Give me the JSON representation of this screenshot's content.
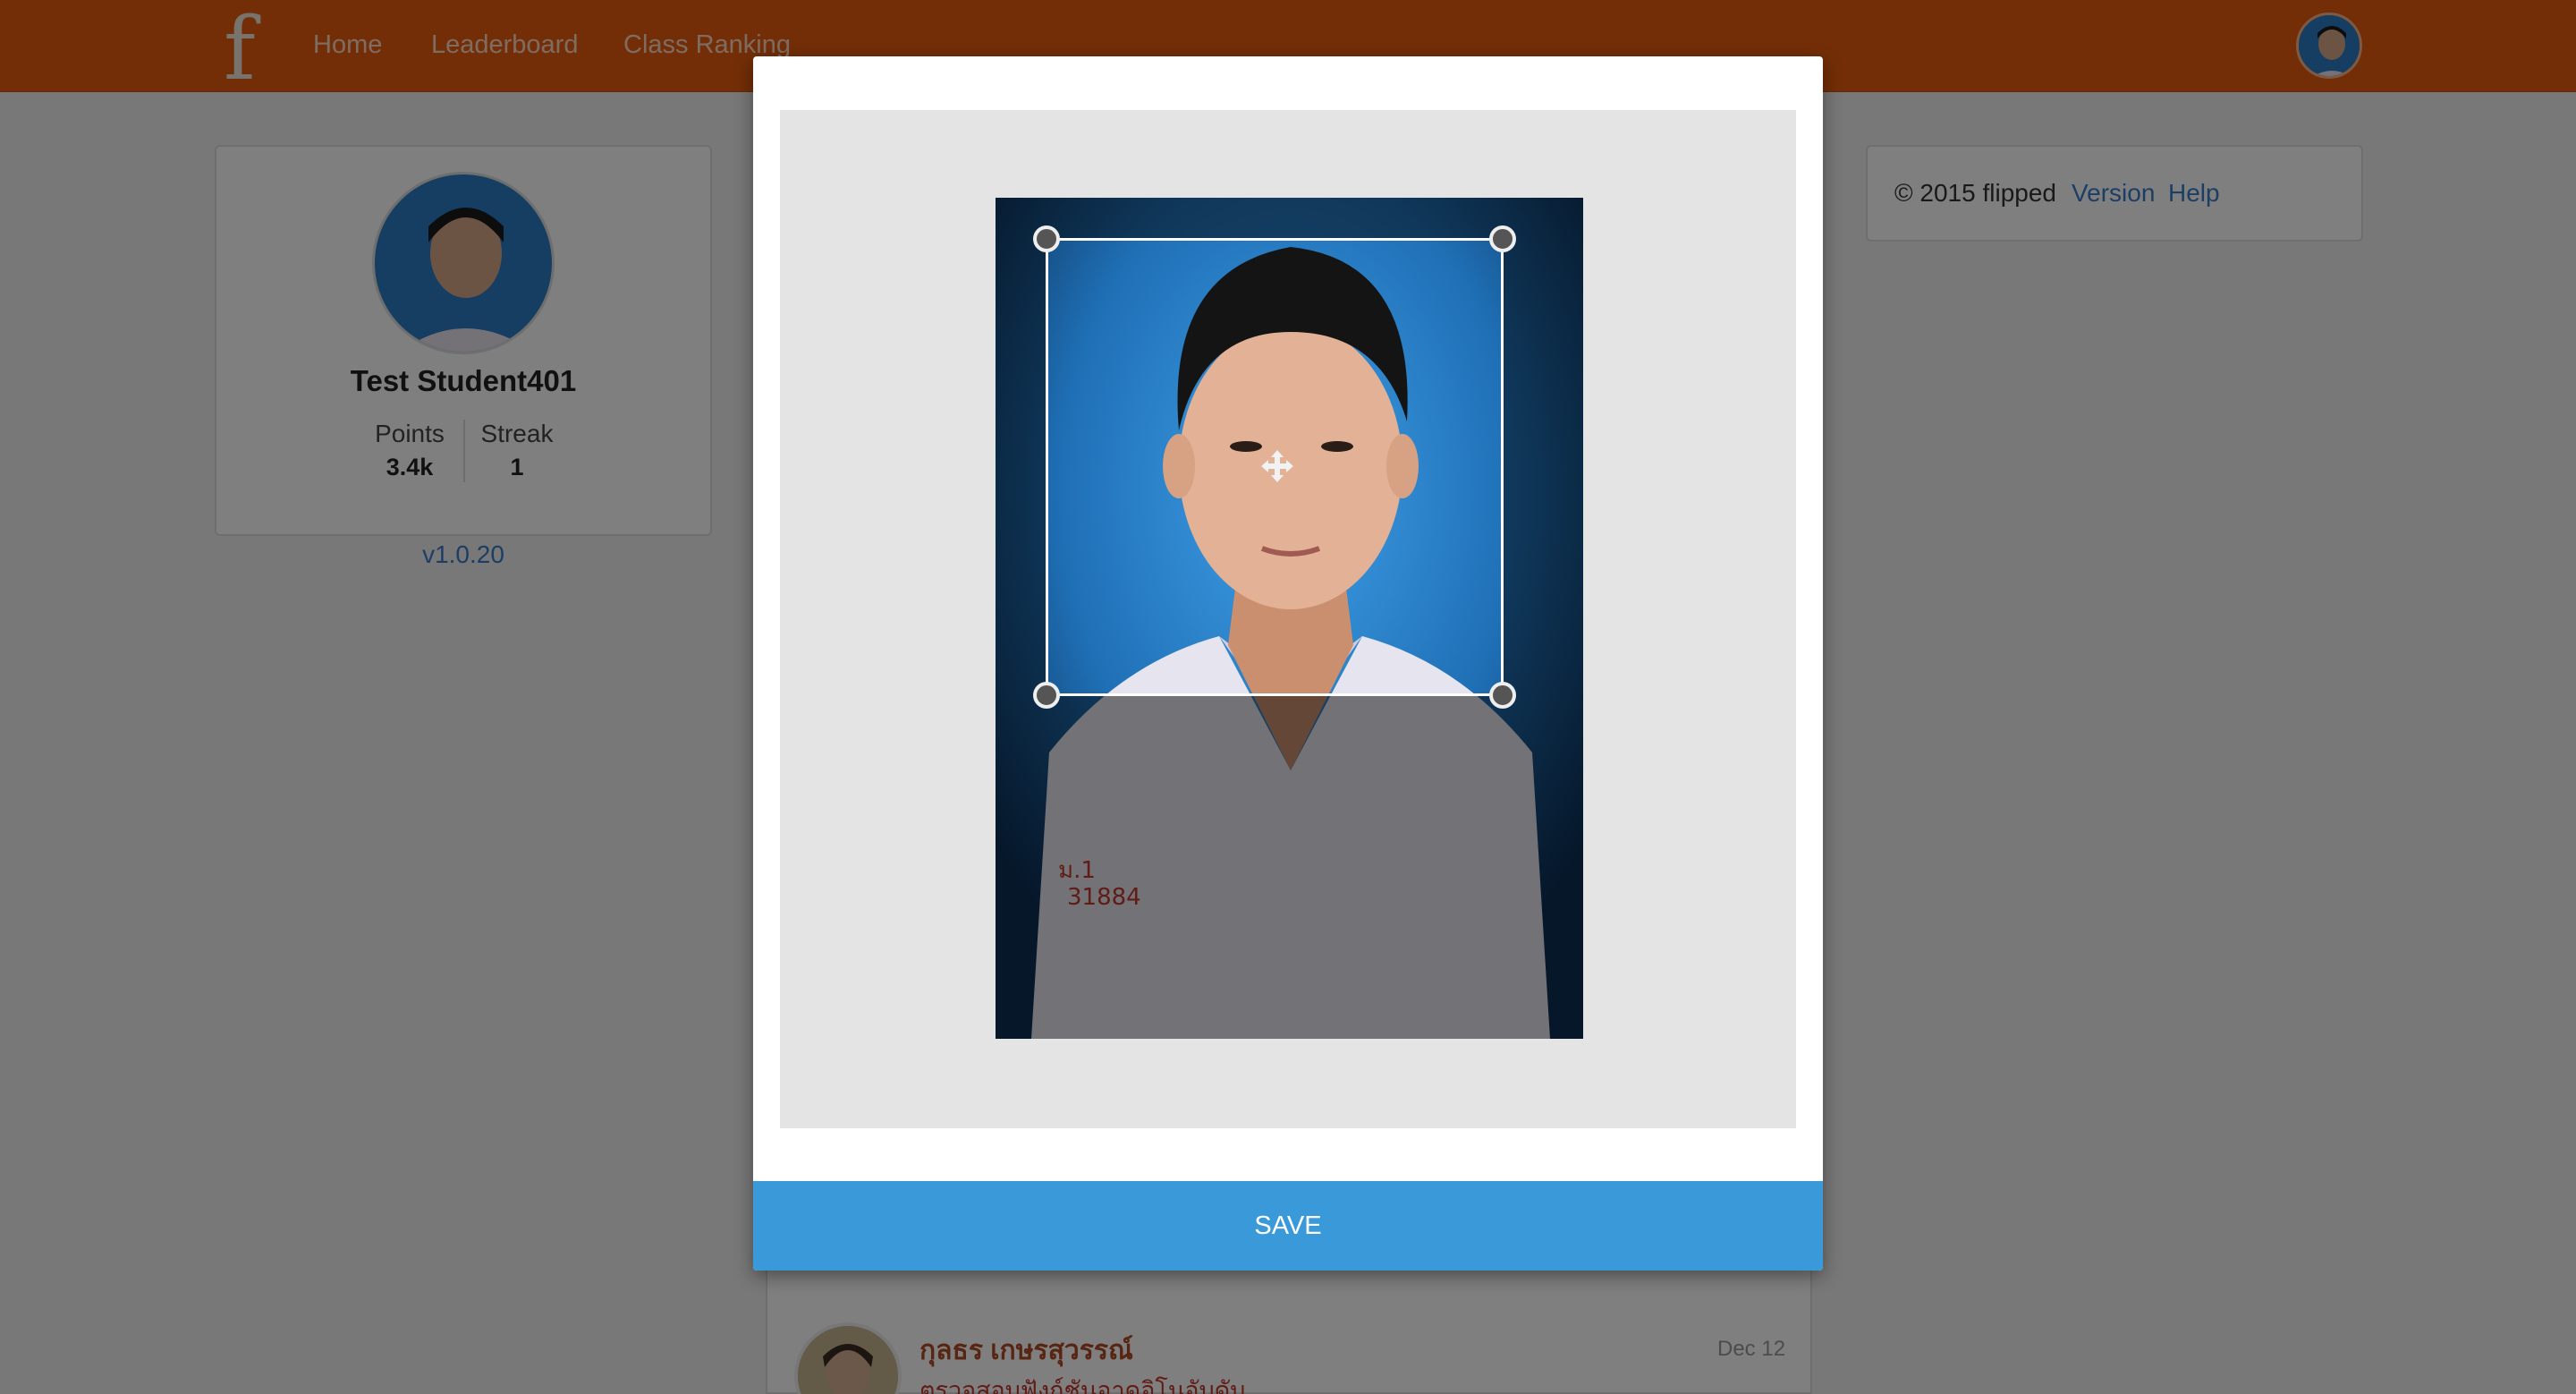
{
  "nav": {
    "brand_letter": "f",
    "links": [
      "Home",
      "Leaderboard",
      "Class Ranking"
    ]
  },
  "profile": {
    "name": "Test Student401",
    "points_label": "Points",
    "points_value": "3.4k",
    "streak_label": "Streak",
    "streak_value": "1",
    "version": "v1.0.20"
  },
  "footer_card": {
    "copyright": "© 2015 flipped",
    "version_link": "Version",
    "help_link": "Help"
  },
  "feed": {
    "author": "กุลธร เกษรสุวรรณ์",
    "date": "Dec 12",
    "text": "ตรวจสอบฟังก์ชันอาดูอิโนอับดับ"
  },
  "modal": {
    "save_label": "SAVE"
  },
  "colors": {
    "navbar": "#e65c0f",
    "link": "#3a7dc8",
    "save_button": "#3a9ad9",
    "photo_background": "#1f6fb5"
  },
  "icons": {
    "move": "move-icon",
    "crop_handles": "crop-handle-icon"
  }
}
